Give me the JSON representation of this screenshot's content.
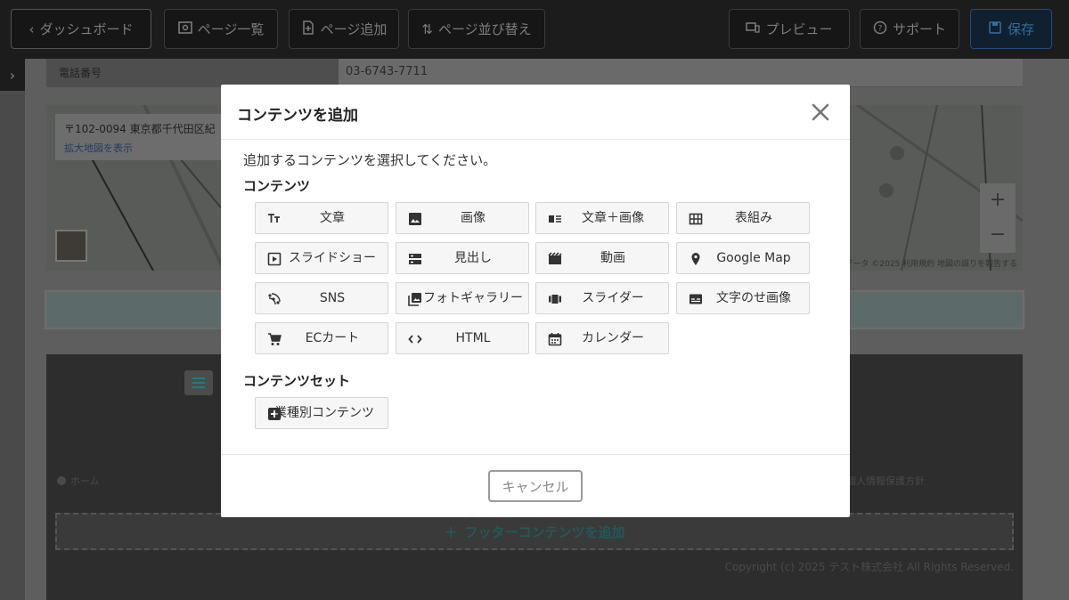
{
  "topbar": {
    "dashboard": "ダッシュボード",
    "page_list": "ページ一覧",
    "add_page": "ページ追加",
    "sort_pages": "ページ並び替え",
    "preview": "プレビュー",
    "support": "サポート",
    "save": "保存"
  },
  "editor": {
    "tel_label": "電話番号",
    "tel_value": "03-6743-7711",
    "map_address": "〒102-0094 東京都千代田区紀",
    "map_link": "拡大地図を表示",
    "map_footer": "データ ©2025 利用規約 地図の誤りを報告する",
    "zoom_in": "+",
    "zoom_out": "−",
    "home_link": "ホーム",
    "privacy_link": "個人情報保護方針",
    "add_footer": "フッターコンテンツを追加",
    "copyright": "Copyright (c) 2025 テスト株式会社 All Rights Reserved."
  },
  "modal": {
    "title": "コンテンツを追加",
    "instruction": "追加するコンテンツを選択してください。",
    "section_contents": "コンテンツ",
    "section_sets": "コンテンツセット",
    "items": [
      {
        "label": "文章",
        "icon": "text-icon"
      },
      {
        "label": "画像",
        "icon": "image-icon"
      },
      {
        "label": "文章＋画像",
        "icon": "text-image-icon"
      },
      {
        "label": "表組み",
        "icon": "table-icon"
      },
      {
        "label": "スライドショー",
        "icon": "slideshow-icon"
      },
      {
        "label": "見出し",
        "icon": "heading-icon"
      },
      {
        "label": "動画",
        "icon": "video-icon"
      },
      {
        "label": "Google Map",
        "icon": "map-pin-icon"
      },
      {
        "label": "SNS",
        "icon": "sns-icon"
      },
      {
        "label": "フォトギャラリー",
        "icon": "photo-gallery-icon"
      },
      {
        "label": "スライダー",
        "icon": "slider-icon"
      },
      {
        "label": "文字のせ画像",
        "icon": "caption-image-icon"
      },
      {
        "label": "ECカート",
        "icon": "cart-icon"
      },
      {
        "label": "HTML",
        "icon": "code-icon"
      },
      {
        "label": "カレンダー",
        "icon": "calendar-icon"
      }
    ],
    "set_items": [
      {
        "label": "業種別コンテンツ",
        "icon": "plus-box-icon"
      }
    ],
    "cancel": "キャンセル"
  },
  "colors": {
    "overlay": "#4a4a4a",
    "modal_bg": "#ffffff",
    "button_bg": "#f6f6f6",
    "button_border": "#d5d5d5",
    "save_accent": "#2f6fa5",
    "teal_accent": "#1e7e7e"
  }
}
